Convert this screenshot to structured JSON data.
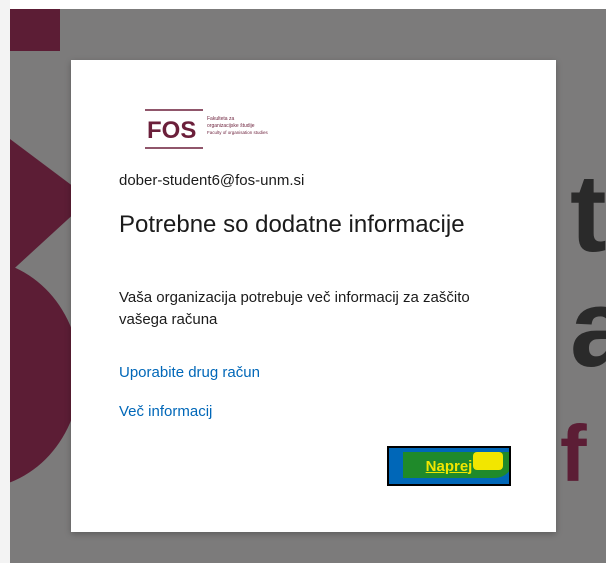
{
  "background": {
    "letters": [
      "t",
      "a",
      "f"
    ],
    "colors": {
      "overlay": "#7c7b7b",
      "maroon": "#5c1d35"
    }
  },
  "dialog": {
    "logo": {
      "wordmark": "FOS",
      "line1": "Fakulteta za",
      "line2": "organizacijske študije",
      "line3": "Faculty of organisation studies"
    },
    "account": "dober-student6@fos-unm.si",
    "title": "Potrebne so dodatne informacije",
    "description": "Vaša organizacija potrebuje več informacij za zaščito vašega računa",
    "links": {
      "use_other_account": "Uporabite drug račun",
      "more_info": "Več informacij"
    },
    "next_button": "Naprej"
  },
  "colors": {
    "link": "#0067b8",
    "button": "#0067b8",
    "text": "#1b1b1b",
    "brand": "#6b1f3a"
  }
}
